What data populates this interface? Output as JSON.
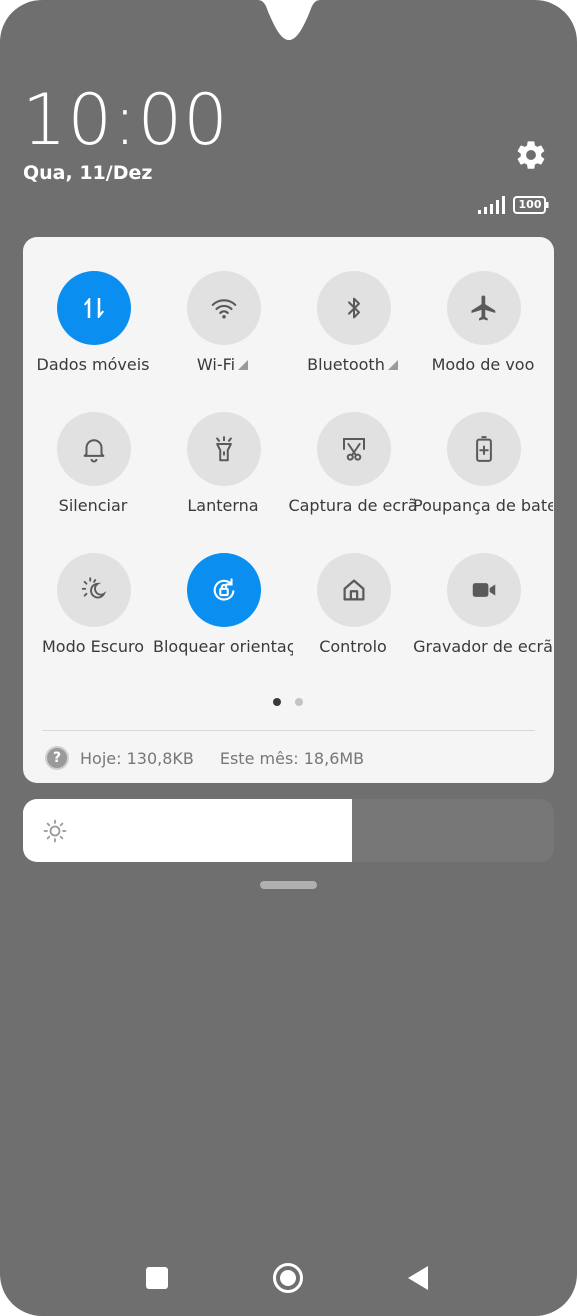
{
  "status": {
    "time": "10:00",
    "date": "Qua, 11/Dez",
    "battery": "100"
  },
  "quick_settings": {
    "tiles": [
      {
        "label": "Dados móveis",
        "icon": "mobile-data-icon",
        "active": true
      },
      {
        "label": "Wi-Fi",
        "icon": "wifi-icon",
        "active": false,
        "expand": true
      },
      {
        "label": "Bluetooth",
        "icon": "bluetooth-icon",
        "active": false,
        "expand": true
      },
      {
        "label": "Modo de voo",
        "icon": "airplane-icon",
        "active": false
      },
      {
        "label": "Silenciar",
        "icon": "bell-icon",
        "active": false
      },
      {
        "label": "Lanterna",
        "icon": "flashlight-icon",
        "active": false
      },
      {
        "label": "Captura de ecrã",
        "icon": "screenshot-icon",
        "active": false
      },
      {
        "label": "Poupança de bateria",
        "icon": "battery-saver-icon",
        "active": false
      },
      {
        "label": "Modo Escuro",
        "icon": "dark-mode-icon",
        "active": false
      },
      {
        "label": "Bloquear orientação",
        "icon": "rotation-lock-icon",
        "active": true
      },
      {
        "label": "Controlo",
        "icon": "home-icon",
        "active": false
      },
      {
        "label": "Gravador de ecrã",
        "icon": "video-camera-icon",
        "active": false
      }
    ],
    "page_count": 2,
    "current_page": 1
  },
  "data_usage": {
    "today": "Hoje: 130,8KB",
    "month": "Este mês: 18,6MB"
  },
  "brightness": {
    "level": 0.62
  },
  "colors": {
    "accent": "#0a8ff0",
    "background": "#6f6f6f",
    "panel": "#f5f5f5",
    "tile_off": "#e1e1e1"
  }
}
